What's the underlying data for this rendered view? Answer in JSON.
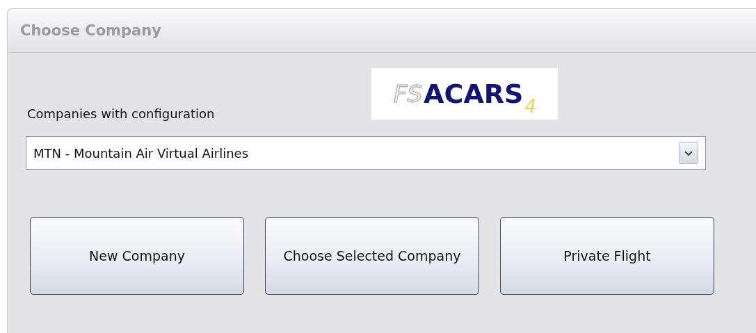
{
  "window": {
    "title": "Choose Company"
  },
  "logo": {
    "prefix": "FS",
    "name": "ACARS",
    "version": "4"
  },
  "companies": {
    "label": "Companies with configuration",
    "value": "MTN - Mountain Air Virtual Airlines"
  },
  "buttons": [
    {
      "label": "New Company"
    },
    {
      "label": "Choose Selected Company"
    },
    {
      "label": "Private Flight"
    }
  ]
}
